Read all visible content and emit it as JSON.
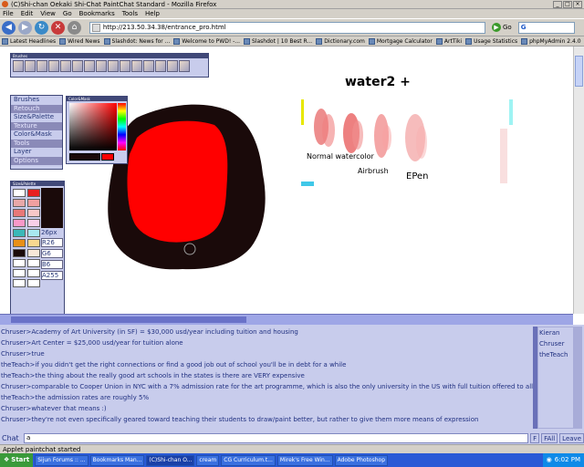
{
  "window": {
    "title": "(C)Shi-chan Oekaki Shi-Chat PaintChat Standard - Mozilla Firefox",
    "controls": [
      "_",
      "□",
      "×"
    ]
  },
  "menu": [
    "File",
    "Edit",
    "View",
    "Go",
    "Bookmarks",
    "Tools",
    "Help"
  ],
  "nav": {
    "url": "http://213.50.34.38/entrance_pro.html",
    "go_label": "Go",
    "search_label": "G"
  },
  "bookmarks": [
    "Latest Headlines",
    "Wired News",
    "Slashdot: News for ...",
    "Welcome to PWD! -...",
    "Slashdot | 10 Best R...",
    "Dictionary.com",
    "Mortgage Calculator",
    "ArtTiki",
    "Usage Statistics",
    "phpMyAdmin 2.4.0"
  ],
  "paint": {
    "brushes_title": "Brushes",
    "colormask_title": "Color&Mask",
    "sizepalette_title": "Size&Palette",
    "menu_items": [
      "Brushes",
      "Retouch",
      "Size&Palette",
      "Texture",
      "Color&Mask",
      "Tools",
      "Layer",
      "Options"
    ],
    "size_label": "26px",
    "r_label": "R26",
    "g_label": "G6",
    "b_label": "B6",
    "a_label": "A255",
    "canvas_text": {
      "heading": "water2 +",
      "normal": "Normal watercolor",
      "airbrush": "Airbrush",
      "epen": "EPen"
    }
  },
  "chat": {
    "messages": [
      "Chruser>Academy of Art University (in SF) = $30,000 usd/year including tuition and housing",
      "Chruser>Art Center = $25,000 usd/year for tuition alone",
      "Chruser>true",
      "theTeach>if you didn't get the right connections or find a good job out of school you'll be in debt for a while",
      "theTeach>the thing about the really good art schools in the states is there are VERY expensive",
      "Chruser>comparable to Cooper Union in NYC with a 7% admission rate for the art programme, which is also the only university in the US with full tuition offered to all stude",
      "theTeach>the admission rates are roughly 5%",
      "Chruser>whatever that means :)",
      "Chruser>they're not even specifically geared toward teaching their students to draw/paint better, but rather to give them more means of expression"
    ],
    "users": [
      "Kieran",
      "Chruser",
      "theTeach"
    ],
    "input_label": "Chat",
    "input_value": "a",
    "buttons": [
      "F",
      "FAll",
      "Leave"
    ]
  },
  "status": "Applet paintchat started",
  "taskbar": {
    "start": "Start",
    "tasks": [
      "Sijun Forums :: ...",
      "Bookmarks Man...",
      "(C)Shi-chan O...",
      "cream",
      "CG Curriculum.t...",
      "Mirek's Free Win...",
      "Adobe Photoshop"
    ],
    "clock": "6:02 PM"
  },
  "colors": {
    "panel_bg": "#c8ccec",
    "accent": "#404878",
    "brush_red": "#ff0000",
    "ink": "#1a0a0a"
  }
}
